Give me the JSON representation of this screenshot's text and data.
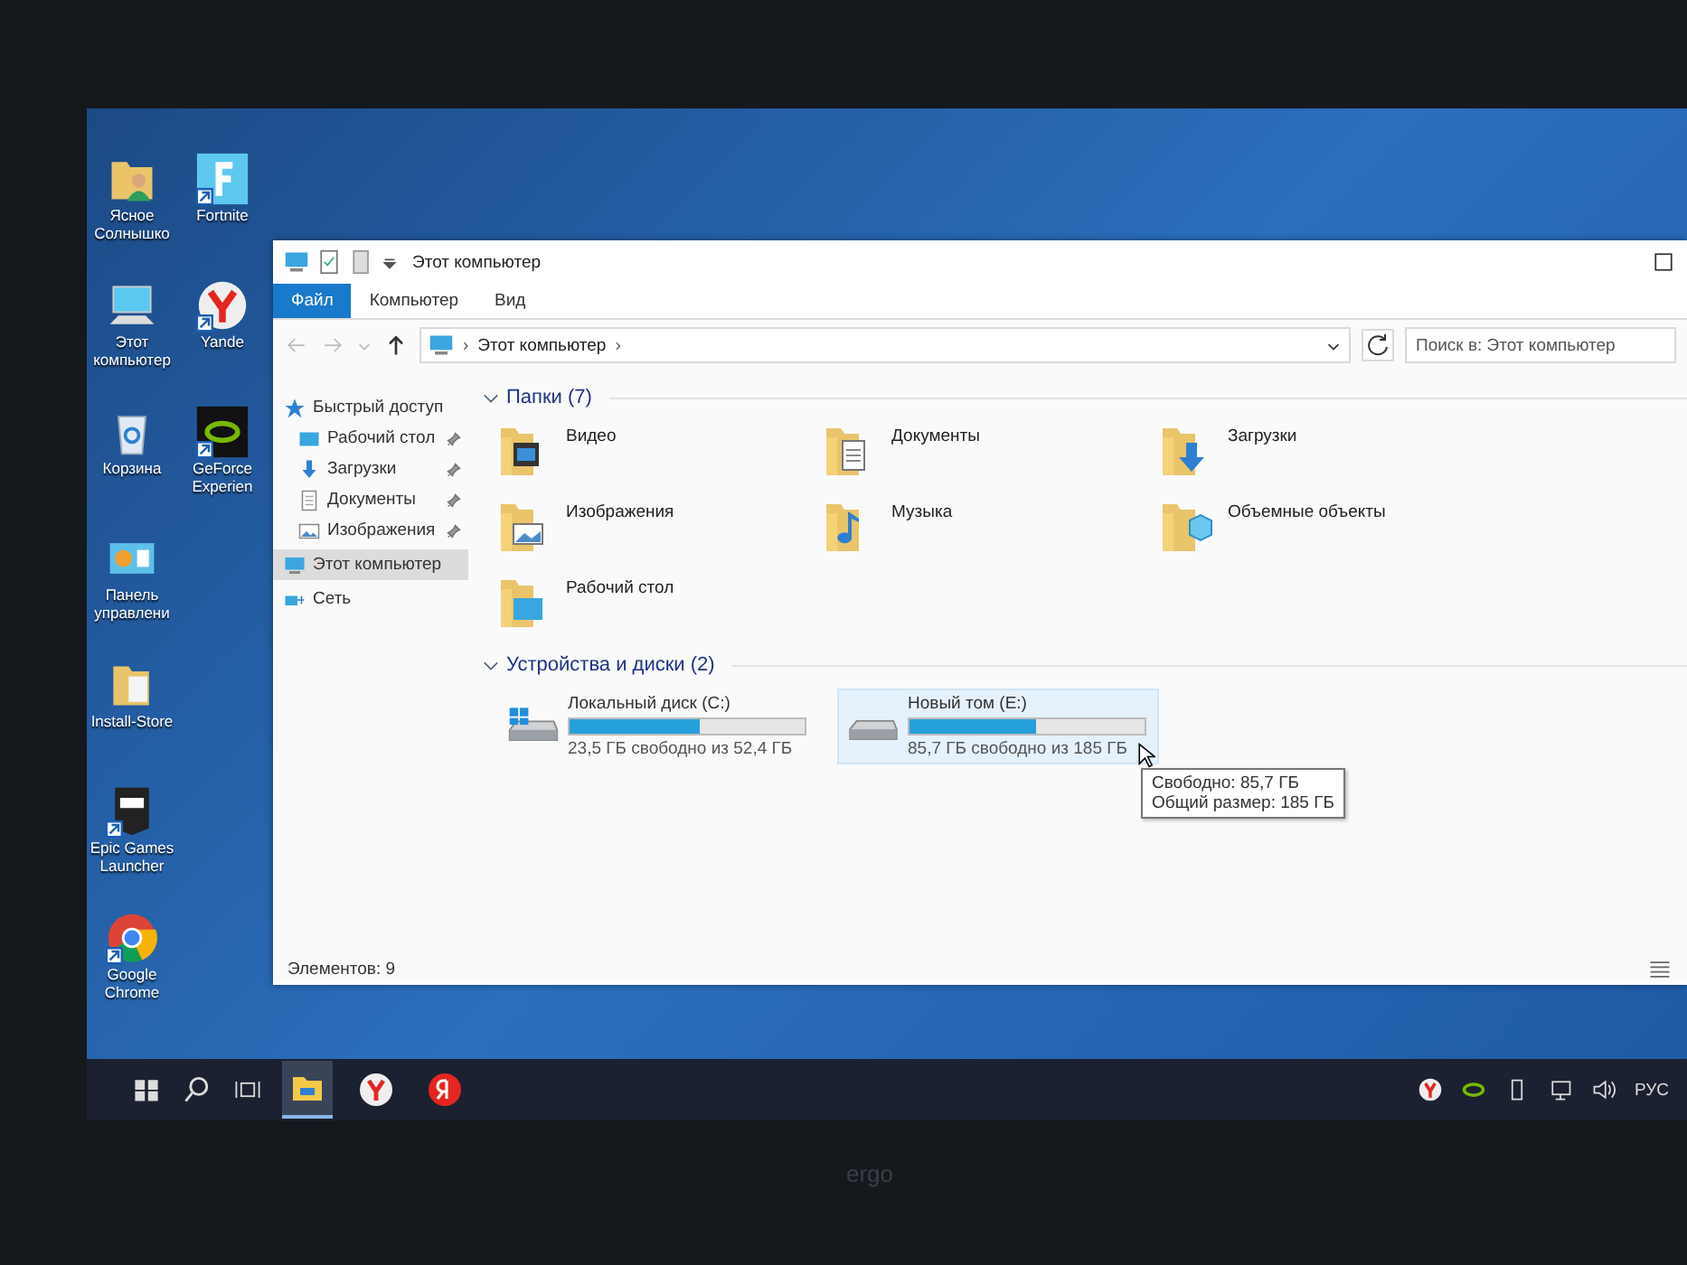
{
  "desktop": {
    "columns": [
      [
        {
          "label": "Ясное Солнышко",
          "kind": "user-folder",
          "shortcut": false
        },
        {
          "label": "Этот компьютер",
          "kind": "computer",
          "shortcut": false
        },
        {
          "label": "Корзина",
          "kind": "recycle",
          "shortcut": false
        },
        {
          "label": "Панель управлени",
          "kind": "control-panel",
          "shortcut": false
        },
        {
          "label": "Install-Store",
          "kind": "folder",
          "shortcut": false
        },
        {
          "label": "Epic Games Launcher",
          "kind": "epic",
          "shortcut": true
        },
        {
          "label": "Google Chrome",
          "kind": "chrome",
          "shortcut": true
        }
      ],
      [
        {
          "label": "Fortnite",
          "kind": "fortnite",
          "shortcut": true
        },
        {
          "label": "Yande",
          "kind": "yandex",
          "shortcut": true
        },
        {
          "label": "GeForce Experien",
          "kind": "nvidia",
          "shortcut": true
        }
      ]
    ]
  },
  "window": {
    "title": "Этот компьютер",
    "tabs": [
      {
        "label": "Файл",
        "selected": true
      },
      {
        "label": "Компьютер",
        "selected": false
      },
      {
        "label": "Вид",
        "selected": false
      }
    ],
    "address": {
      "separator_before": "›",
      "path": "Этот компьютер",
      "separator_after": "›"
    },
    "search": {
      "placeholder": "Поиск в: Этот компьютер"
    },
    "nav": [
      {
        "label": "Быстрый доступ",
        "kind": "star",
        "selected": false,
        "children": [
          {
            "label": "Рабочий стол",
            "kind": "desktop",
            "pinned": true
          },
          {
            "label": "Загрузки",
            "kind": "download",
            "pinned": true
          },
          {
            "label": "Документы",
            "kind": "document",
            "pinned": true
          },
          {
            "label": "Изображения",
            "kind": "picture",
            "pinned": true
          }
        ]
      },
      {
        "label": "Этот компьютер",
        "kind": "computer",
        "selected": true
      },
      {
        "label": "Сеть",
        "kind": "network",
        "selected": false
      }
    ],
    "folders_group": {
      "title": "Папки (7)",
      "expanded": true
    },
    "folders": [
      {
        "label": "Видео",
        "kind": "video"
      },
      {
        "label": "Документы",
        "kind": "document"
      },
      {
        "label": "Загрузки",
        "kind": "download"
      },
      {
        "label": "Изображения",
        "kind": "picture"
      },
      {
        "label": "Музыка",
        "kind": "music"
      },
      {
        "label": "Объемные объекты",
        "kind": "objects"
      },
      {
        "label": "Рабочий стол",
        "kind": "desktop"
      }
    ],
    "drives_group": {
      "title": "Устройства и диски (2)",
      "expanded": true
    },
    "drives": [
      {
        "name": "Локальный диск (C:)",
        "kind": "system",
        "level": 0.55,
        "free": "23,5 ГБ свободно из 52,4 ГБ",
        "selected": false
      },
      {
        "name": "Новый том (E:)",
        "kind": "data",
        "level": 0.54,
        "free": "85,7 ГБ свободно из 185 ГБ",
        "selected": true
      }
    ],
    "tooltip": [
      "Свободно: 85,7 ГБ",
      "Общий размер: 185 ГБ"
    ],
    "status": "Элементов: 9"
  },
  "taskbar": {
    "apps": [
      {
        "kind": "explorer",
        "selected": true
      },
      {
        "kind": "yandex-browser",
        "selected": false
      },
      {
        "kind": "yandex",
        "selected": false
      }
    ],
    "tray": {
      "language": "РУС"
    }
  },
  "monitor_brand": "ergo"
}
